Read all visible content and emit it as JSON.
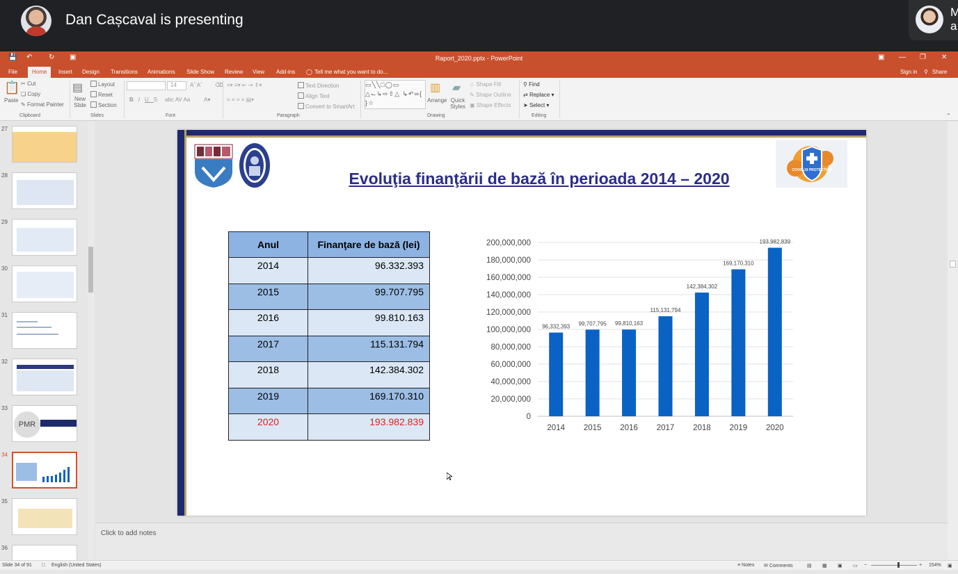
{
  "meet": {
    "presenter_text": "Dan Cașcaval is presenting",
    "side_tile_text": "M\na"
  },
  "window": {
    "title": "Raport_2020.pptx - PowerPoint",
    "sign_in": "Sign in",
    "share": "Share",
    "tell_me": "Tell me what you want to do...",
    "tabs": [
      "File",
      "Home",
      "Insert",
      "Design",
      "Transitions",
      "Animations",
      "Slide Show",
      "Review",
      "View",
      "Add-ins"
    ]
  },
  "ribbon": {
    "clipboard": {
      "paste": "Paste",
      "cut": "Cut",
      "copy": "Copy",
      "format_painter": "Format Painter",
      "label": "Clipboard"
    },
    "slides": {
      "new_slide": "New Slide",
      "layout": "Layout",
      "reset": "Reset",
      "section": "Section",
      "label": "Slides"
    },
    "font": {
      "size": "14",
      "label": "Font",
      "bold": "B",
      "italic": "I",
      "underline": "U",
      "strike": "S",
      "abc": "abc",
      "av": "AV",
      "aa": "Aa"
    },
    "paragraph": {
      "text_direction": "Text Direction",
      "align_text": "Align Text",
      "smartart": "Convert to SmartArt",
      "label": "Paragraph"
    },
    "drawing": {
      "arrange": "Arrange",
      "quick_styles": "Quick Styles",
      "shape_fill": "Shape Fill",
      "shape_outline": "Shape Outline",
      "shape_effects": "Shape Effects",
      "label": "Drawing"
    },
    "editing": {
      "find": "Find",
      "replace": "Replace",
      "select": "Select",
      "label": "Editing"
    }
  },
  "thumbnails": [
    "27",
    "28",
    "29",
    "30",
    "31",
    "32",
    "33",
    "34",
    "35",
    "36"
  ],
  "thumb_pmr": "PMR",
  "slide": {
    "title": "Evoluţia finanţării de bază în perioada 2014 – 2020",
    "logo_text": "COVID-19 PROTECTION",
    "table": {
      "headers": [
        "Anul",
        "Finanţare de bază (lei)"
      ],
      "rows": [
        {
          "year": "2014",
          "value": "96.332.393"
        },
        {
          "year": "2015",
          "value": "99.707.795"
        },
        {
          "year": "2016",
          "value": "99.810.163"
        },
        {
          "year": "2017",
          "value": "115.131.794"
        },
        {
          "year": "2018",
          "value": "142.384.302"
        },
        {
          "year": "2019",
          "value": "169.170.310"
        },
        {
          "year": "2020",
          "value": "193.982.839"
        }
      ]
    }
  },
  "chart_data": {
    "type": "bar",
    "categories": [
      "2014",
      "2015",
      "2016",
      "2017",
      "2018",
      "2019",
      "2020"
    ],
    "values": [
      96332393,
      99707795,
      99810163,
      115131794,
      142384302,
      169170310,
      193982839
    ],
    "data_labels": [
      "96,332,393",
      "99,707,795",
      "99,810,163",
      "115,131,794",
      "142,384,302",
      "169,170,310",
      "193,982,839"
    ],
    "ylim": [
      0,
      200000000
    ],
    "yticks": [
      "0",
      "20,000,000",
      "40,000,000",
      "60,000,000",
      "80,000,000",
      "100,000,000",
      "120,000,000",
      "140,000,000",
      "160,000,000",
      "180,000,000",
      "200,000,000"
    ],
    "bar_color": "#0a62c4",
    "grid": true,
    "title": "",
    "xlabel": "",
    "ylabel": ""
  },
  "notes_placeholder": "Click to add notes",
  "status": {
    "slide": "Slide 34 of 91",
    "language": "English (United States)",
    "notes": "Notes",
    "comments": "Comments",
    "zoom": "154%"
  }
}
